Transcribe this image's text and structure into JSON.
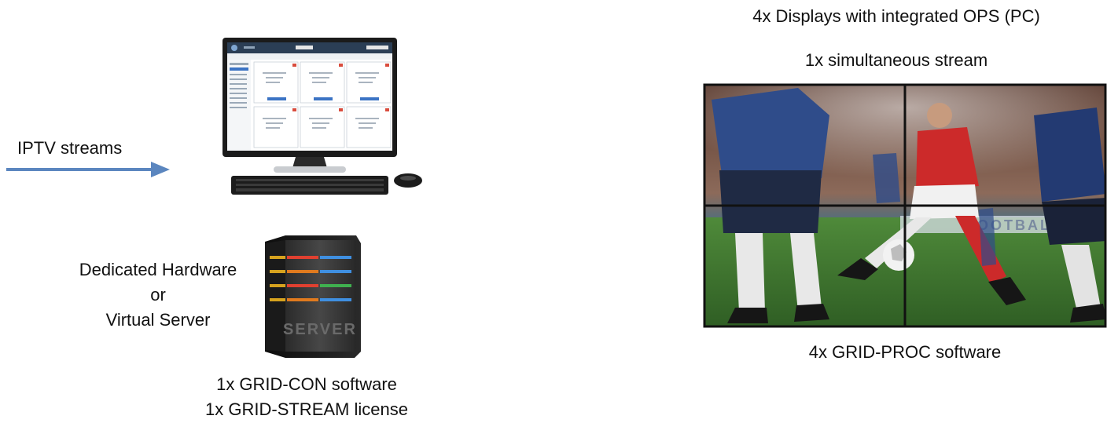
{
  "left": {
    "iptv_label": "IPTV streams",
    "hardware_label": {
      "line1": "Dedicated Hardware",
      "line2": "or",
      "line3": "Virtual Server"
    },
    "server_text": "SERVER",
    "monitor_ui": {
      "logo": "TERACUE",
      "brand": "SPLIDE"
    },
    "software_lines": [
      "1x GRID-CON software",
      "1x GRID-STREAM license"
    ]
  },
  "right": {
    "title_line1": "4x Displays with integrated OPS (PC)",
    "title_line2": "1x simultaneous stream",
    "footer": "4x GRID-PROC software",
    "banner_text": "FOOTBALL"
  },
  "colors": {
    "arrow": "#5b86bf",
    "grid_border": "#111111",
    "pitch": "#4f8a3a"
  }
}
